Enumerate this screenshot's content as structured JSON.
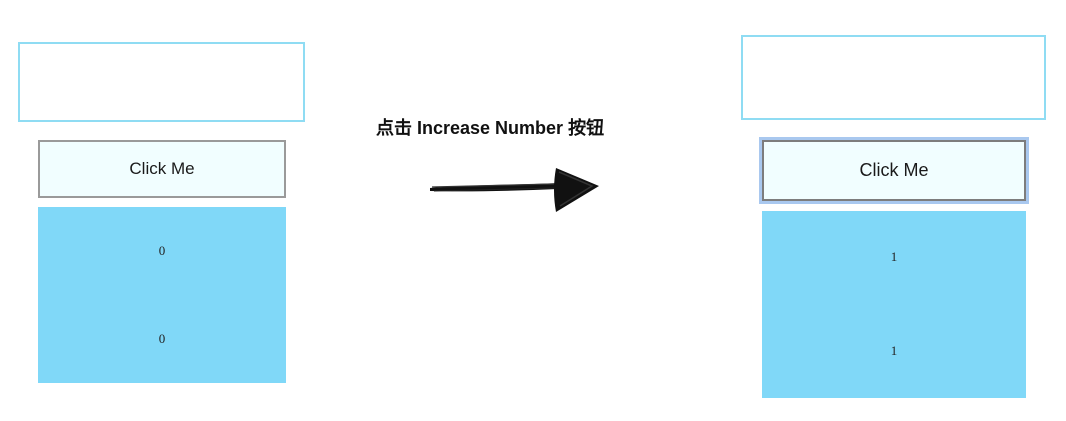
{
  "caption": "点击 Increase Number 按钮",
  "before": {
    "button_label": "Click Me",
    "values": [
      "0",
      "0"
    ]
  },
  "after": {
    "button_label": "Click Me",
    "values": [
      "1",
      "1"
    ]
  },
  "colors": {
    "outline": "#8fdcf3",
    "button_bg": "#f1feff",
    "panel_bg": "#80d8f8",
    "focus_ring": "#a9c8ef"
  },
  "icons": [
    "arrow-right-icon"
  ]
}
